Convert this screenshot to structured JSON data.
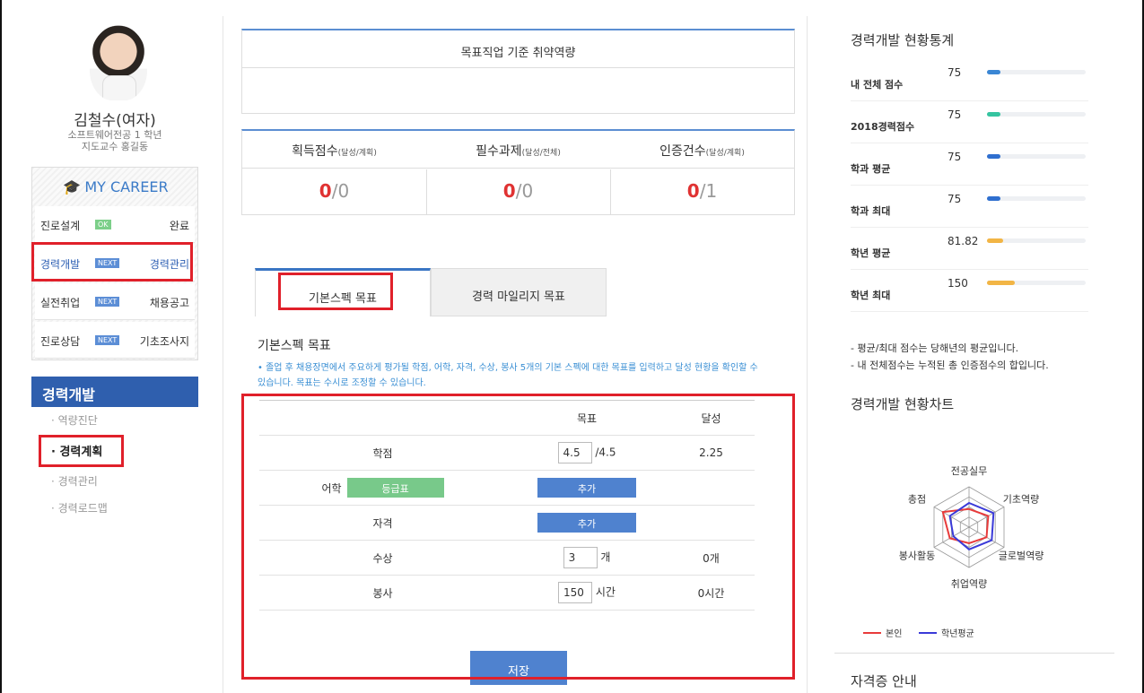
{
  "profile": {
    "name": "김철수(여자)",
    "dept": "소프트웨어전공 1 학년",
    "advisor": "지도교수 홍길동"
  },
  "my_career": {
    "title": "MY CAREER",
    "rows": [
      {
        "label": "진로설계",
        "tag": "OK",
        "right": "완료"
      },
      {
        "label": "경력개발",
        "tag": "NEXT",
        "right": "경력관리"
      },
      {
        "label": "실전취업",
        "tag": "NEXT",
        "right": "채용공고"
      },
      {
        "label": "진로상담",
        "tag": "NEXT",
        "right": "기초조사지"
      }
    ]
  },
  "section": {
    "title": "경력개발",
    "items": [
      "· 역량진단",
      "· 경력계획",
      "· 경력관리",
      "· 경력로드맵"
    ]
  },
  "goal_box": {
    "title": "목표직업 기준 취약역량"
  },
  "scores": [
    {
      "label": "획득점수",
      "sub": "(달성/계획)",
      "value": "0",
      "total": "/0"
    },
    {
      "label": "필수과제",
      "sub": "(달성/전체)",
      "value": "0",
      "total": "/0"
    },
    {
      "label": "인증건수",
      "sub": "(달성/계획)",
      "value": "0",
      "total": "/1"
    }
  ],
  "tabs": [
    "기본스펙 목표",
    "경력 마일리지 목표"
  ],
  "form": {
    "title": "기본스펙 목표",
    "desc": "• 졸업 후 채용장면에서 주요하게 평가될 학점, 어학, 자격, 수상, 봉사 5개의 기본 스펙에 대한 목표를 입력하고 달성 현황을 확인할 수 있습니다. 목표는 수시로 조정할 수 있습니다.",
    "headers": [
      "",
      "목표",
      "달성"
    ],
    "rows": {
      "gpa": {
        "label": "학점",
        "value": "4.5",
        "unit": "/4.5",
        "achieved": "2.25"
      },
      "lang": {
        "label": "어학",
        "grade_btn": "등급표",
        "add_btn": "추가"
      },
      "cert": {
        "label": "자격",
        "add_btn": "추가"
      },
      "award": {
        "label": "수상",
        "value": "3",
        "unit": "개",
        "achieved": "0개"
      },
      "volunteer": {
        "label": "봉사",
        "value": "150",
        "unit": "시간",
        "achieved": "0시간"
      }
    },
    "save_label": "저장"
  },
  "stats": {
    "title": "경력개발 현황통계",
    "rows": [
      {
        "label": "내 전체 점수",
        "value": "75",
        "ratio": 0.14,
        "color": "#3a86d4"
      },
      {
        "label": "2018경력점수",
        "value": "75",
        "ratio": 0.14,
        "color": "#35c4a0"
      },
      {
        "label": "학과 평균",
        "value": "75",
        "ratio": 0.14,
        "color": "#2f6fcf"
      },
      {
        "label": "학과 최대",
        "value": "75",
        "ratio": 0.14,
        "color": "#2f6fcf"
      },
      {
        "label": "학년 평균",
        "value": "81.82",
        "ratio": 0.16,
        "color": "#f2b545"
      },
      {
        "label": "학년 최대",
        "value": "150",
        "ratio": 0.28,
        "color": "#f2b545"
      }
    ],
    "notes": [
      "- 평균/최대 점수는 당해년의 평균입니다.",
      "- 내 전체점수는 누적된 총 인증점수의 합입니다."
    ]
  },
  "chart_title": "경력개발 현황차트",
  "chart_data": {
    "type": "radar",
    "categories": [
      "전공실무",
      "기초역량",
      "글로벌역량",
      "취업역량",
      "봉사활동",
      "총점"
    ],
    "series": [
      {
        "name": "본인",
        "color": "#e83b3b",
        "values": [
          0.45,
          0.55,
          0.5,
          0.4,
          0.55,
          0.75
        ]
      },
      {
        "name": "학년평균",
        "color": "#3a3ad8",
        "values": [
          0.6,
          0.7,
          0.65,
          0.55,
          0.45,
          0.55
        ]
      }
    ]
  },
  "cert_title": "자격증 안내"
}
